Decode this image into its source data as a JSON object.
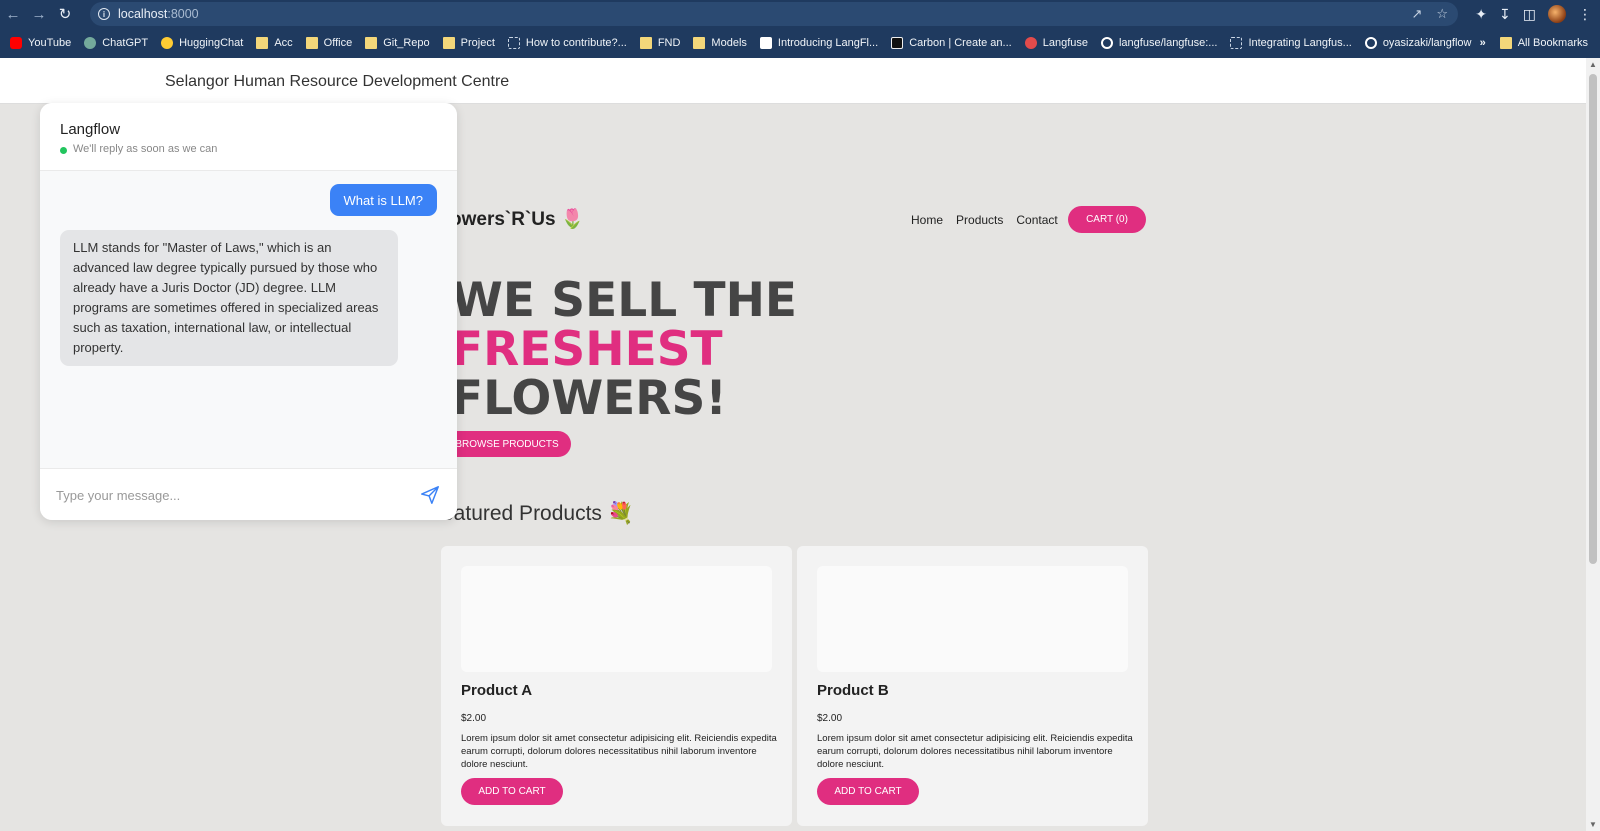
{
  "browser": {
    "url_host": "localhost",
    "url_port": ":8000",
    "bookmarks": [
      {
        "label": "YouTube",
        "icon": "youtube-icon"
      },
      {
        "label": "ChatGPT",
        "icon": "chatgpt-icon"
      },
      {
        "label": "HuggingChat",
        "icon": "huggingchat-icon"
      },
      {
        "label": "Acc",
        "icon": "folder-icon"
      },
      {
        "label": "Office",
        "icon": "folder-icon"
      },
      {
        "label": "Git_Repo",
        "icon": "folder-icon"
      },
      {
        "label": "Project",
        "icon": "folder-icon"
      },
      {
        "label": "How to contribute?...",
        "icon": "page-icon"
      },
      {
        "label": "FND",
        "icon": "folder-icon"
      },
      {
        "label": "Models",
        "icon": "folder-icon"
      },
      {
        "label": "Introducing LangFl...",
        "icon": "langflow-icon"
      },
      {
        "label": "Carbon | Create an...",
        "icon": "carbon-icon"
      },
      {
        "label": "Langfuse",
        "icon": "langfuse-icon"
      },
      {
        "label": "langfuse/langfuse:...",
        "icon": "github-icon"
      },
      {
        "label": "Integrating Langfus...",
        "icon": "page-icon"
      },
      {
        "label": "oyasizaki/langflow",
        "icon": "github-icon"
      }
    ],
    "more_label": "»",
    "all_bookmarks": "All Bookmarks"
  },
  "site": {
    "header_title": "Selangor Human Resource Development Centre",
    "brand": "owers`R`Us 🌷",
    "nav": [
      "Home",
      "Products",
      "Contact"
    ],
    "cart_label": "CART (0)",
    "hero_line1": "WE SELL THE",
    "hero_line2": "FRESHEST",
    "hero_line3": "FLOWERS!",
    "browse_label": "BROWSE PRODUCTS",
    "featured_title": "eatured Products 💐",
    "products": [
      {
        "name": "Product A",
        "price": "$2.00",
        "desc": "Lorem ipsum dolor sit amet consectetur adipisicing elit. Reiciendis expedita earum corrupti, dolorum dolores necessitatibus nihil laborum inventore dolore nesciunt.",
        "button": "ADD TO CART"
      },
      {
        "name": "Product B",
        "price": "$2.00",
        "desc": "Lorem ipsum dolor sit amet consectetur adipisicing elit. Reiciendis expedita earum corrupti, dolorum dolores necessitatibus nihil laborum inventore dolore nesciunt.",
        "button": "ADD TO CART"
      }
    ]
  },
  "chat": {
    "title": "Langflow",
    "status": "We'll reply as soon as we can",
    "user_message": "What is LLM?",
    "bot_message": "LLM stands for \"Master of Laws,\" which is an advanced law degree typically pursued by those who already have a Juris Doctor (JD) degree. LLM programs are sometimes offered in specialized areas such as taxation, international law, or intellectual property.",
    "input_placeholder": "Type your message...",
    "accent_color": "#3b82f6",
    "status_color": "#22c55e"
  },
  "colors": {
    "brand_pink": "#e02e80",
    "browser_bar": "#1f3a5f"
  }
}
